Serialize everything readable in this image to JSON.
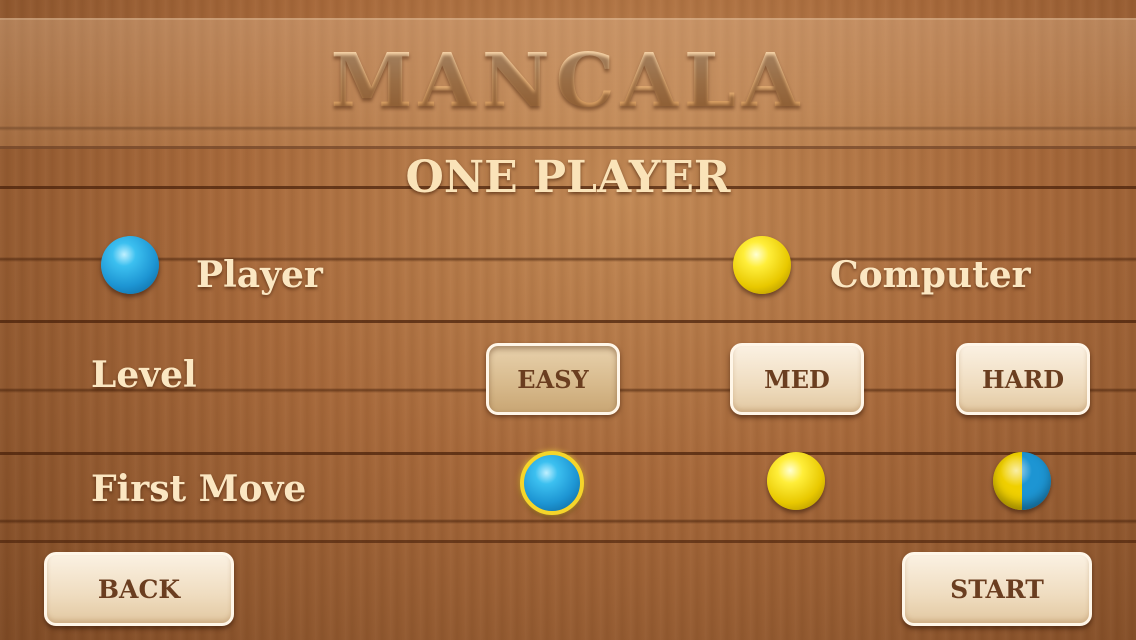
{
  "game": {
    "title": "MANCALA",
    "mode": "ONE PLAYER"
  },
  "players": {
    "player_label": "Player",
    "player_color": "#1d95d3",
    "computer_label": "Computer",
    "computer_color": "#e8c800"
  },
  "level": {
    "label": "Level",
    "options": [
      "EASY",
      "MED",
      "HARD"
    ],
    "selected": "EASY"
  },
  "first_move": {
    "label": "First Move",
    "options": [
      "player-blue",
      "computer-yellow",
      "random-half"
    ],
    "selected": "player-blue"
  },
  "nav": {
    "back_label": "BACK",
    "start_label": "START"
  }
}
